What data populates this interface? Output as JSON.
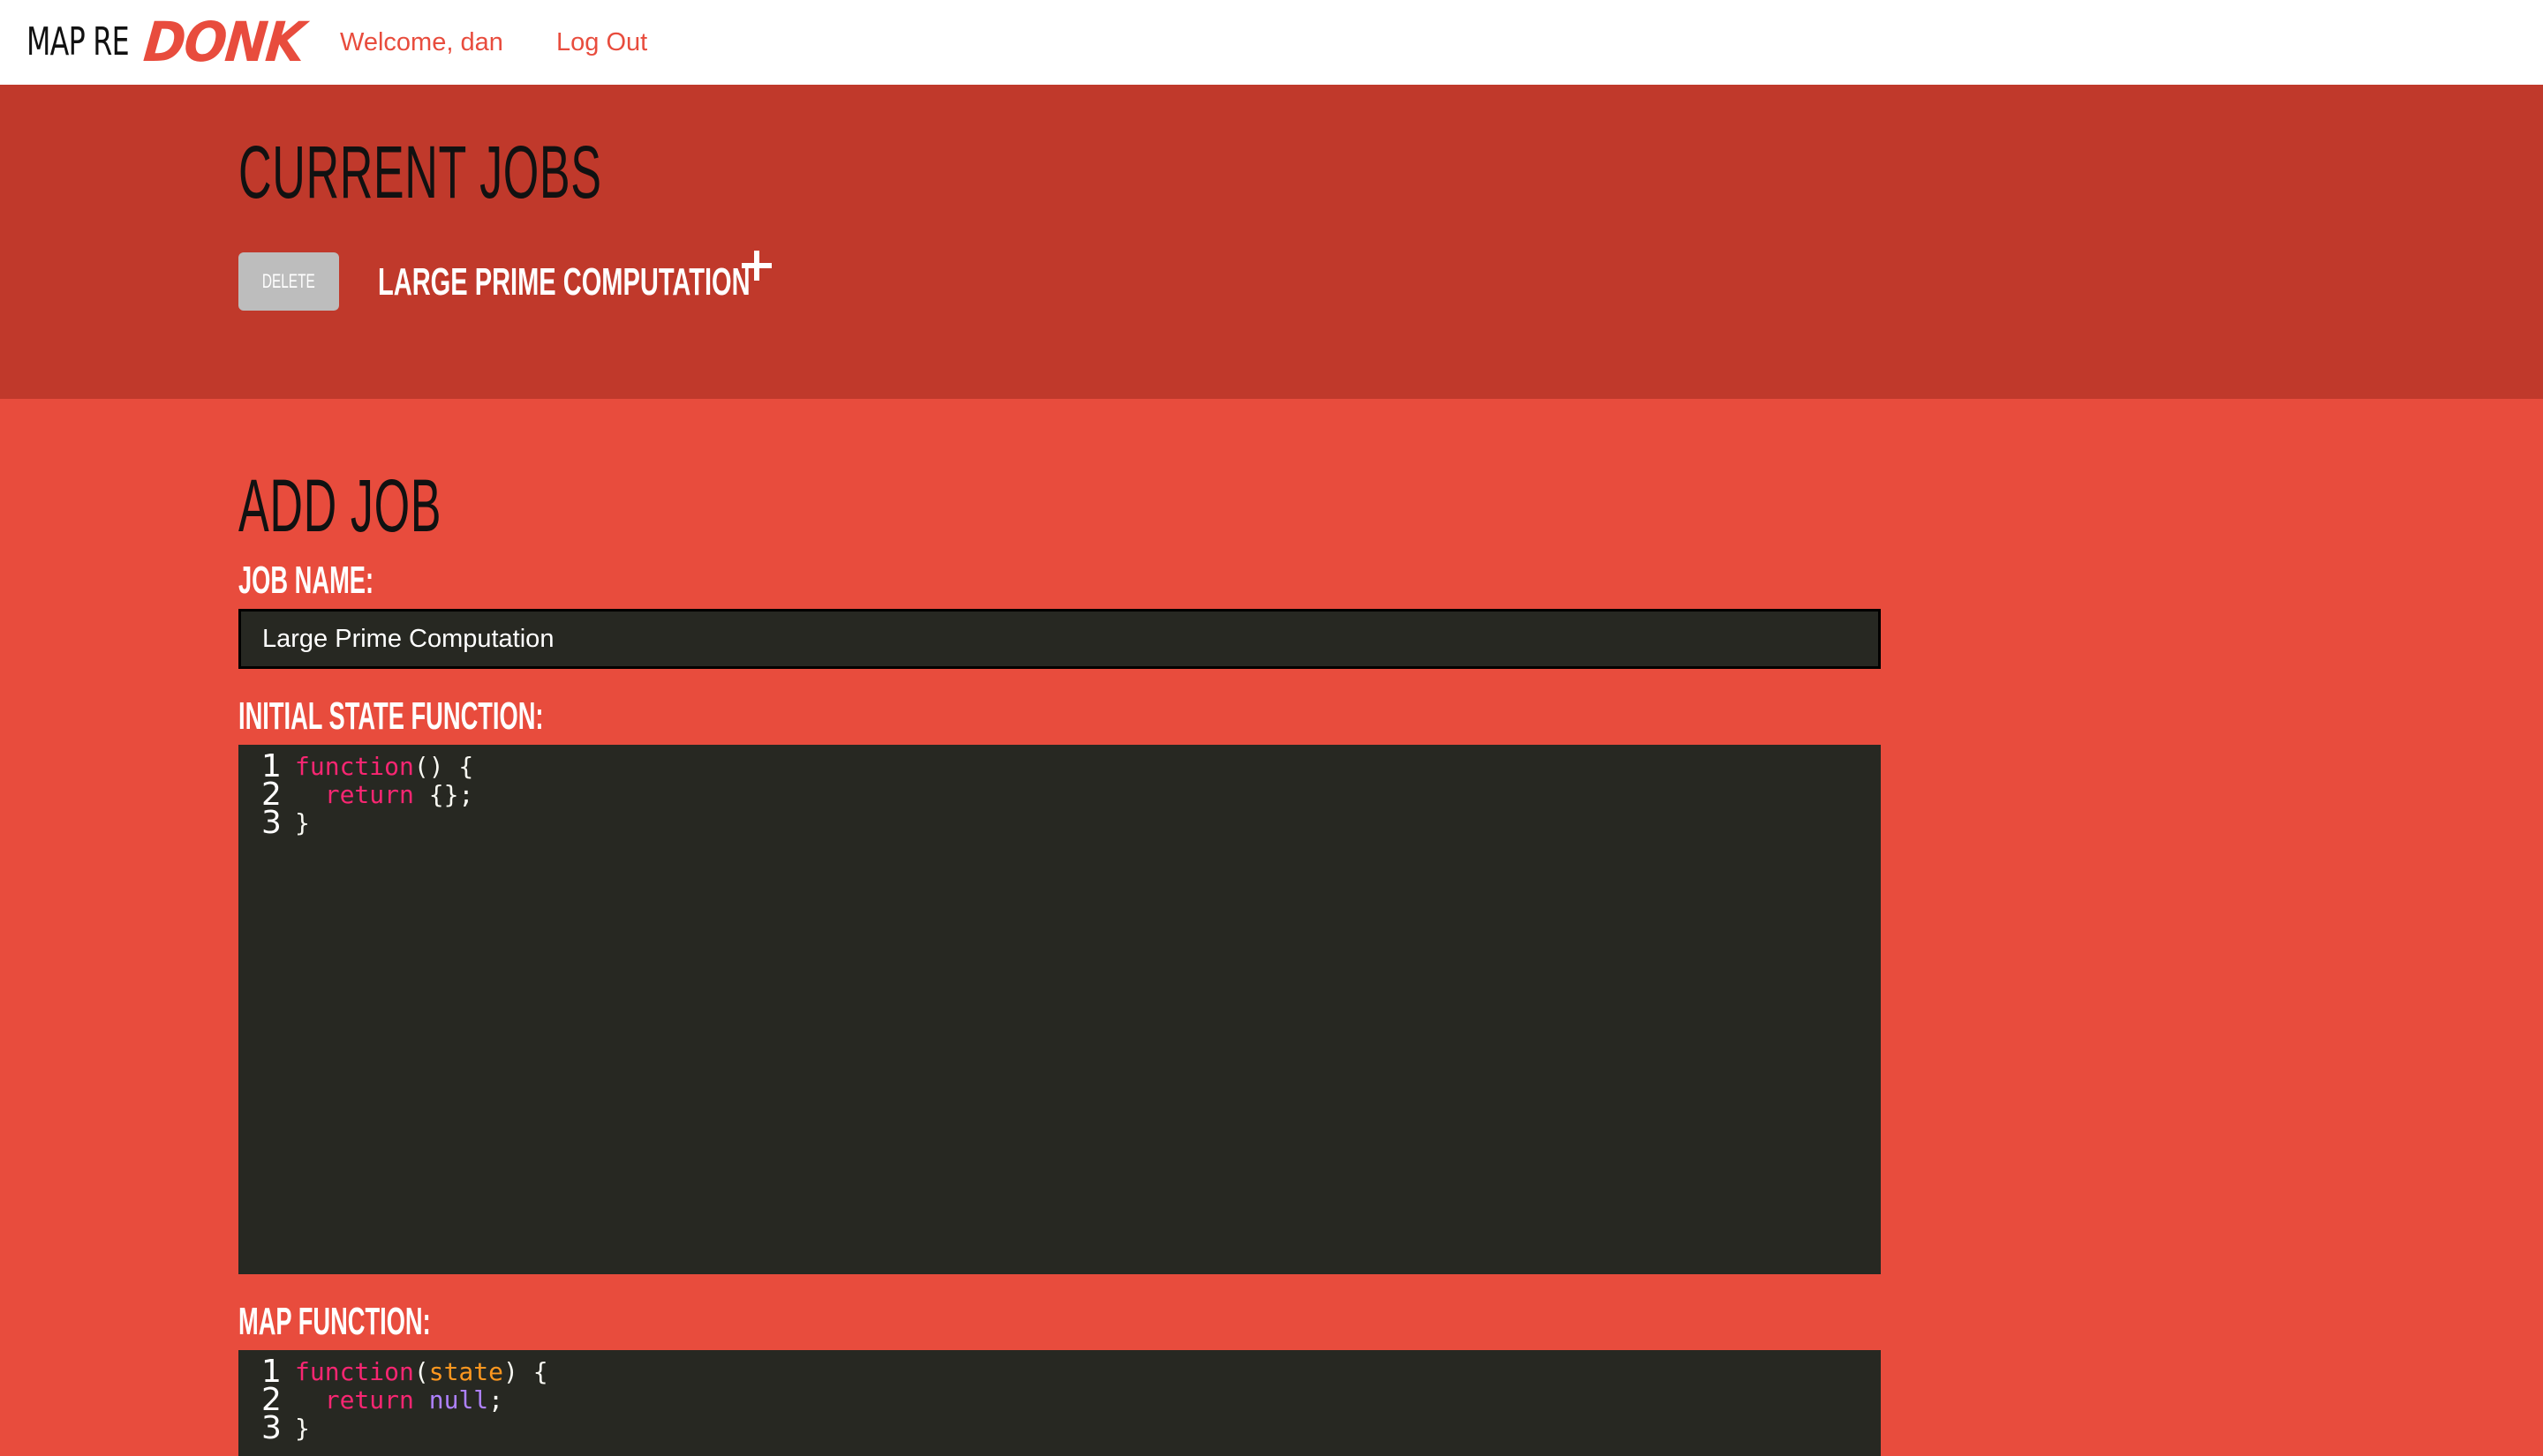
{
  "navbar": {
    "logo_prefix": "MAP RE",
    "logo_suffix": "DONK",
    "welcome_text": "Welcome, dan",
    "logout_text": "Log Out"
  },
  "current_jobs": {
    "title": "CURRENT JOBS",
    "jobs": [
      {
        "delete_label": "DELETE",
        "name": "LARGE PRIME COMPUTATION"
      }
    ]
  },
  "add_job": {
    "title": "ADD JOB",
    "job_name_label": "JOB NAME:",
    "job_name_value": "Large Prime Computation",
    "initial_state_label": "INITIAL STATE FUNCTION:",
    "initial_state_code": [
      {
        "num": "1",
        "parts": [
          [
            "kw",
            "function"
          ],
          [
            "txt",
            "() {"
          ]
        ]
      },
      {
        "num": "2",
        "parts": [
          [
            "txt",
            "  "
          ],
          [
            "kw",
            "return"
          ],
          [
            "txt",
            " {};"
          ]
        ]
      },
      {
        "num": "3",
        "parts": [
          [
            "txt",
            "}"
          ]
        ]
      }
    ],
    "map_label": "MAP FUNCTION:",
    "map_code": [
      {
        "num": "1",
        "parts": [
          [
            "kw",
            "function"
          ],
          [
            "txt",
            "("
          ],
          [
            "arg",
            "state"
          ],
          [
            "txt",
            ") {"
          ]
        ]
      },
      {
        "num": "2",
        "parts": [
          [
            "txt",
            "  "
          ],
          [
            "kw",
            "return"
          ],
          [
            "txt",
            " "
          ],
          [
            "const",
            "null"
          ],
          [
            "txt",
            ";"
          ]
        ]
      },
      {
        "num": "3",
        "parts": [
          [
            "txt",
            "}"
          ]
        ]
      }
    ]
  },
  "colors": {
    "primary_red": "#e84c3d",
    "dark_red": "#c0392b",
    "editor_bg": "#272822",
    "keyword": "#f92672",
    "argument": "#fd971f",
    "constant": "#ae81ff"
  }
}
